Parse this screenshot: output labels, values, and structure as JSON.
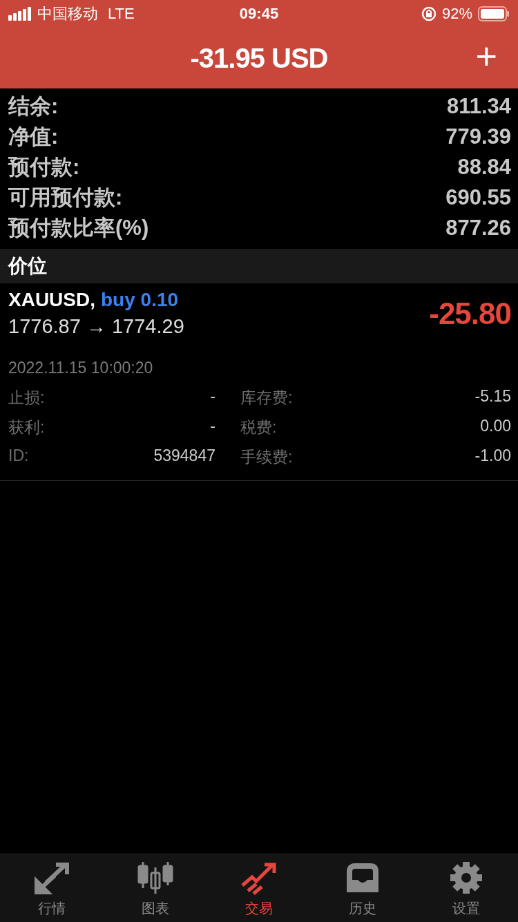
{
  "status_bar": {
    "carrier": "中国移动",
    "network": "LTE",
    "time": "09:45",
    "battery": "92%"
  },
  "header": {
    "title": "-31.95 USD",
    "action": "+"
  },
  "summary": [
    {
      "label": "结余:",
      "value": "811.34"
    },
    {
      "label": "净值:",
      "value": "779.39"
    },
    {
      "label": "预付款:",
      "value": "88.84"
    },
    {
      "label": "可用预付款:",
      "value": "690.55"
    },
    {
      "label": "预付款比率(%)",
      "value": "877.26"
    }
  ],
  "section": {
    "title": "价位"
  },
  "positions": [
    {
      "symbol": "XAUUSD,",
      "side": "buy 0.10",
      "prices": "1776.87 → 1774.29",
      "profit": "-25.80",
      "time": "2022.11.15 10:00:20",
      "details": [
        {
          "label": "止损:",
          "value": "-"
        },
        {
          "label": "库存费:",
          "value": "-5.15"
        },
        {
          "label": "获利:",
          "value": "-"
        },
        {
          "label": "税费:",
          "value": "0.00"
        },
        {
          "label": "ID:",
          "value": "5394847"
        },
        {
          "label": "手续费:",
          "value": "-1.00"
        }
      ]
    }
  ],
  "tabs": [
    {
      "kind": "markets",
      "label": "行情",
      "selected": false
    },
    {
      "kind": "chart",
      "label": "图表",
      "selected": false
    },
    {
      "kind": "trade",
      "label": "交易",
      "selected": true
    },
    {
      "kind": "history",
      "label": "历史",
      "selected": false
    },
    {
      "kind": "settings",
      "label": "设置",
      "selected": false
    }
  ]
}
